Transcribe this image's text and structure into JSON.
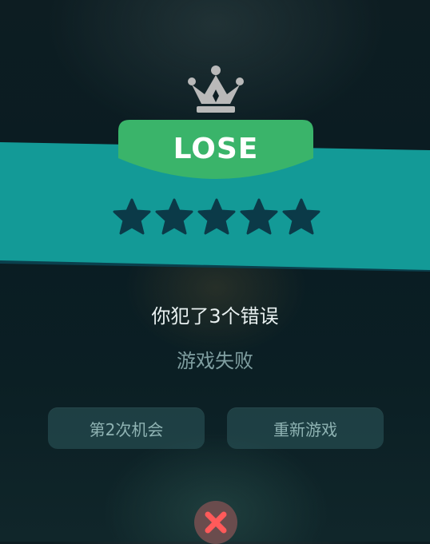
{
  "result": {
    "badge_text": "LOSE",
    "stars_earned": 0,
    "stars_total": 5
  },
  "messages": {
    "mistakes": "你犯了3个错误",
    "status": "游戏失败"
  },
  "buttons": {
    "second_chance": "第2次机会",
    "restart": "重新游戏"
  },
  "icons": {
    "crown": "crown-icon",
    "close": "close-icon",
    "star": "star-icon"
  },
  "colors": {
    "band": "#139a97",
    "plate": "#3ab46a",
    "star_empty": "#0b3a48",
    "crown": "#b9b9b9",
    "close_bg": "#6a4c4d",
    "close_x": "#ff5a5a"
  }
}
